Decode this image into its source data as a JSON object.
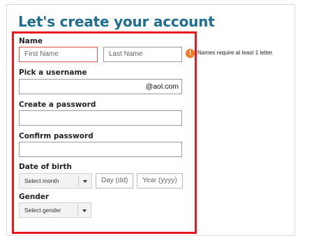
{
  "form": {
    "title": "Let's create your account",
    "name": {
      "label": "Name",
      "first_placeholder": "First Name",
      "last_placeholder": "Last Name",
      "error_message": "Names require at least 1 letter.",
      "error_icon": "!"
    },
    "username": {
      "label": "Pick a username",
      "suffix": "@aol.com"
    },
    "password": {
      "label": "Create a password"
    },
    "confirm_password": {
      "label": "Confirm password"
    },
    "dob": {
      "label": "Date of birth",
      "month_selected": "Select month",
      "day_placeholder": "Day (dd)",
      "year_placeholder": "Year (yyyy)"
    },
    "gender": {
      "label": "Gender",
      "selected": "Select gender"
    }
  },
  "colors": {
    "title": "#1e6e8c",
    "highlight_border": "#e8171f",
    "error_field_border": "#d9534f",
    "error_icon": "#f07e26"
  }
}
